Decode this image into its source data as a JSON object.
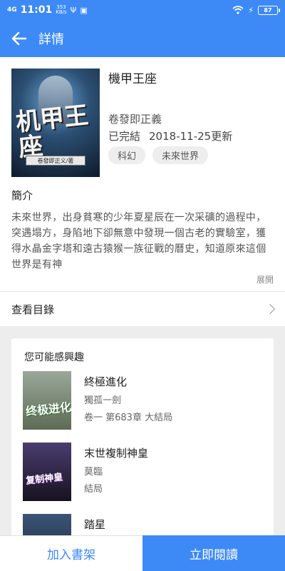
{
  "status_bar": {
    "signal": "4G",
    "time": "11:01",
    "speed_value": "353",
    "speed_unit": "KB/s",
    "battery": "87",
    "colors": {
      "background": "#3d8af7",
      "text": "#ffffff"
    }
  },
  "app_bar": {
    "title": "詳情",
    "back_icon": "arrow-left-icon"
  },
  "book": {
    "title": "機甲王座",
    "cover_title": "机甲王座",
    "cover_author_tag": "卷發即正义/著",
    "author": "卷發即正義",
    "status": "已完結",
    "updated": "2018-11-25更新",
    "tags": [
      "科幻",
      "未來世界"
    ],
    "intro_heading": "簡介",
    "intro": "未來世界，出身貧寒的少年夏星辰在一次采礦的過程中，突遇塌方，身陷地下卻無意中發現一個古老的實驗室，獲得水晶金字塔和遠古猿猴一族征戰的曆史，知道原來這個世界是有神",
    "expand_label": "展開"
  },
  "catalog": {
    "label": "查看目錄",
    "icon": "chevron-right-icon"
  },
  "recommend": {
    "heading": "您可能感興趣",
    "items": [
      {
        "title": "終極進化",
        "author": "獨孤一劍",
        "chapter": "卷一 第683章 大結局",
        "cover_text": "终极进化",
        "cover_color": "#5e6b55"
      },
      {
        "title": "末世複制神皇",
        "author": "莫臨",
        "chapter": "結局",
        "cover_text": "复制神皇",
        "cover_color": "#2a2340"
      },
      {
        "title": "踏星",
        "author": "",
        "chapter": "",
        "cover_text": "",
        "cover_color": "#2a3a55"
      }
    ]
  },
  "bottom_bar": {
    "add_shelf": "加入書架",
    "read_now": "立即閱讀",
    "accent": "#3d8af7"
  }
}
